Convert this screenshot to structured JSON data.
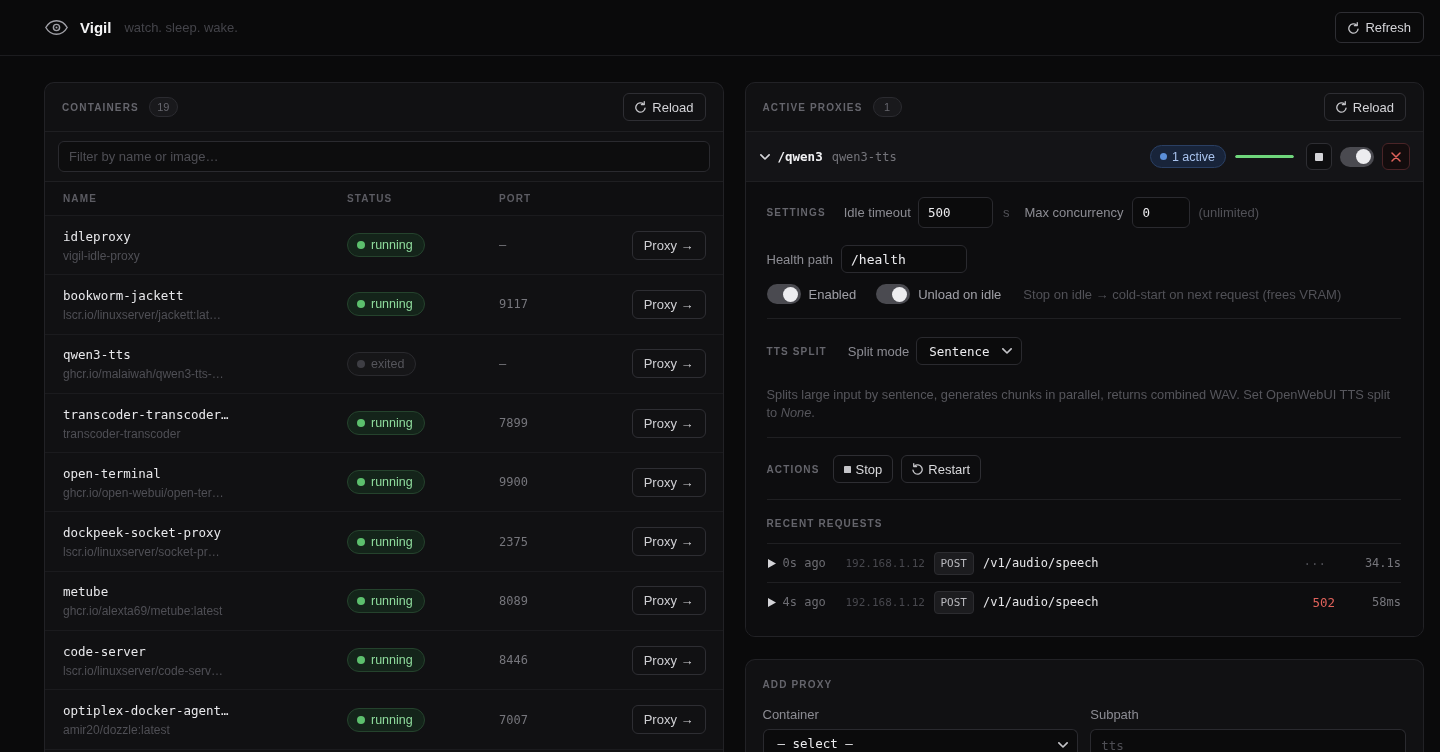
{
  "header": {
    "title": "Vigil",
    "tagline": "watch. sleep. wake.",
    "refresh_button": "Refresh"
  },
  "containers": {
    "title": "CONTAINERS",
    "count": "19",
    "reload_button": "Reload",
    "filter": {
      "placeholder": "Filter by name or image…"
    },
    "columns": [
      "NAME",
      "STATUS",
      "PORT"
    ],
    "rows": [
      {
        "name": "idleproxy",
        "image": "vigil-idle-proxy",
        "status": "running",
        "running": true,
        "port": "—",
        "action": "Proxy →"
      },
      {
        "name": "bookworm-jackett",
        "image": "lscr.io/linuxserver/jackett:lat…",
        "status": "running",
        "running": true,
        "port": "9117",
        "action": "Proxy →"
      },
      {
        "name": "qwen3-tts",
        "image": "ghcr.io/malaiwah/qwen3-tts-…",
        "status": "exited",
        "running": false,
        "port": "—",
        "action": "Proxy →"
      },
      {
        "name": "transcoder-transcoder…",
        "image": "transcoder-transcoder",
        "status": "running",
        "running": true,
        "port": "7899",
        "action": "Proxy →"
      },
      {
        "name": "open-terminal",
        "image": "ghcr.io/open-webui/open-ter…",
        "status": "running",
        "running": true,
        "port": "9900",
        "action": "Proxy →"
      },
      {
        "name": "dockpeek-socket-proxy",
        "image": "lscr.io/linuxserver/socket-pr…",
        "status": "running",
        "running": true,
        "port": "2375",
        "action": "Proxy →"
      },
      {
        "name": "metube",
        "image": "ghcr.io/alexta69/metube:latest",
        "status": "running",
        "running": true,
        "port": "8089",
        "action": "Proxy →"
      },
      {
        "name": "code-server",
        "image": "lscr.io/linuxserver/code-serv…",
        "status": "running",
        "running": true,
        "port": "8446",
        "action": "Proxy →"
      },
      {
        "name": "optiplex-docker-agent…",
        "image": "amir20/dozzle:latest",
        "status": "running",
        "running": true,
        "port": "7007",
        "action": "Proxy →"
      }
    ]
  },
  "proxies": {
    "title": "ACTIVE PROXIES",
    "count": "1",
    "reload_button": "Reload",
    "items": [
      {
        "expanded": true,
        "path": "/qwen3",
        "container": "qwen3-tts",
        "active_badge": "1 active",
        "level": 1,
        "enabled": true,
        "settings": {
          "label": "SETTINGS",
          "idle_timeout": {
            "label": "Idle timeout",
            "value": "500",
            "unit": "s"
          },
          "max_concurrency": {
            "label": "Max concurrency",
            "value": "0",
            "note": "(unlimited)"
          },
          "health_path": {
            "label": "Health path",
            "value": "/health"
          }
        },
        "toggles": [
          {
            "label": "Enabled",
            "on": true
          },
          {
            "label": "Unload on idle",
            "on": true
          }
        ],
        "toggle_note": "Stop on idle → cold-start on next request (frees VRAM)",
        "tts_split": {
          "label": "TTS SPLIT",
          "field_label": "Split mode",
          "value": "Sentence",
          "description": "Splits large input by sentence, generates chunks in parallel, returns combined WAV. Set OpenWebUI TTS split to *None*."
        },
        "actions": {
          "label": "ACTIONS",
          "buttons": [
            {
              "label": "Stop",
              "kind": "stop"
            },
            {
              "label": "Restart",
              "kind": "restart"
            }
          ]
        },
        "recent_requests": {
          "label": "RECENT REQUESTS",
          "rows": [
            {
              "age": "0s ago",
              "ip": "192.168.1.12",
              "method": "POST",
              "path": "/v1/audio/speech",
              "status": "···",
              "error": false,
              "duration": "34.1s"
            },
            {
              "age": "4s ago",
              "ip": "192.168.1.12",
              "method": "POST",
              "path": "/v1/audio/speech",
              "status": "502",
              "error": true,
              "duration": "58ms"
            }
          ]
        }
      }
    ]
  },
  "add_proxy": {
    "title": "ADD PROXY",
    "fields": [
      {
        "kind": "select",
        "label": "Container",
        "value": "— select —"
      },
      {
        "kind": "text",
        "label": "Subpath",
        "placeholder": "tts"
      }
    ]
  }
}
